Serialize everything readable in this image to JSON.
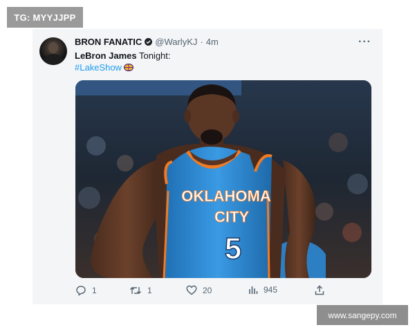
{
  "watermarks": {
    "top": "TG: MYYJJPP",
    "bottom": "www.sangepy.com"
  },
  "tweet": {
    "display_name": "BRON FANATIC",
    "handle": "@WarlyKJ",
    "separator": "·",
    "time": "4m",
    "more_label": "···",
    "text_bold": "LeBron James",
    "text_rest": " Tonight:",
    "hashtag": "#LakeShow",
    "image": {
      "jersey_line1": "OKLAHOMA",
      "jersey_line2": "CITY",
      "jersey_number": "5"
    },
    "actions": {
      "replies": "1",
      "retweets": "1",
      "likes": "20",
      "views": "945"
    }
  },
  "colors": {
    "link": "#1d9bf0",
    "secondary_text": "#536471",
    "jersey_blue": "#2f8fd8",
    "jersey_trim": "#f07b24"
  },
  "icons": [
    "verified-badge-icon",
    "lakers-logo-emoji",
    "reply-icon",
    "retweet-icon",
    "like-icon",
    "views-icon",
    "share-icon",
    "more-options-icon"
  ]
}
